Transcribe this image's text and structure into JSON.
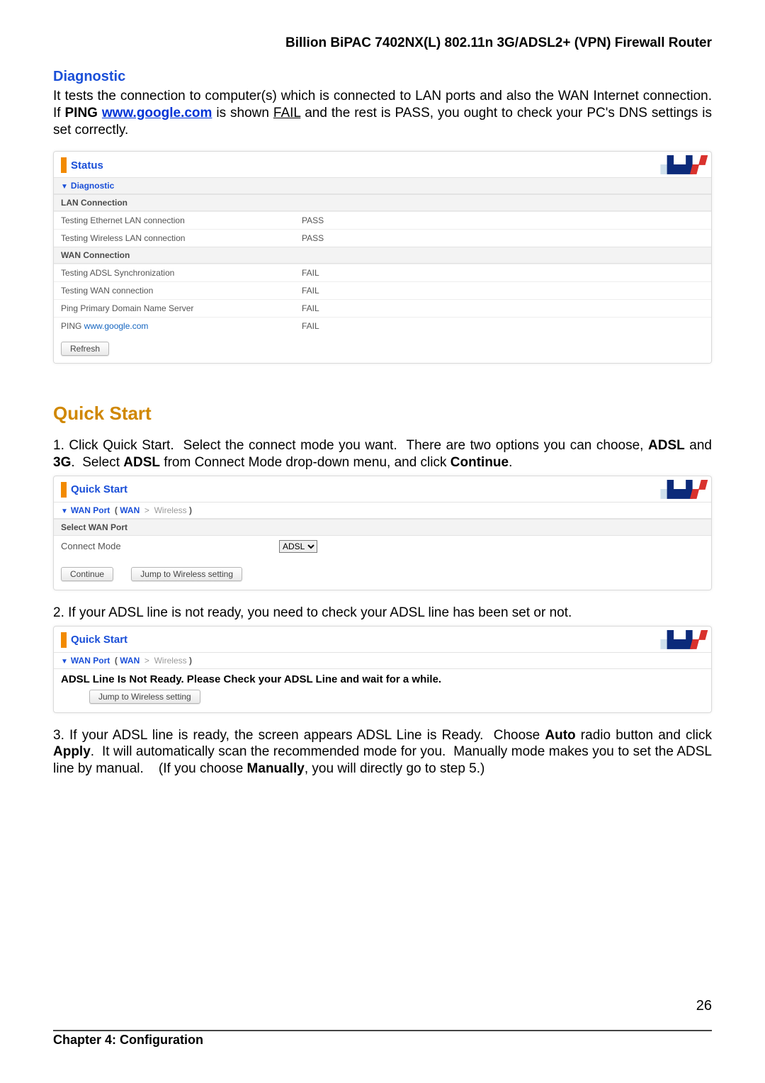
{
  "document": {
    "title": "Billion BiPAC 7402NX(L) 802.11n 3G/ADSL2+ (VPN) Firewall Router",
    "chapter": "Chapter 4: Configuration",
    "page_number": "26"
  },
  "diag_section": {
    "heading": "Diagnostic",
    "para_before": "It tests the connection to computer(s) which is connected to LAN ports and also the WAN Internet connection.  If ",
    "ping_bold": "PING ",
    "ping_link": "www.google.com",
    "para_mid": " is shown ",
    "fail_word": "FAIL",
    "para_after": " and the rest is PASS, you ought to check your PC's DNS settings is set correctly."
  },
  "diag_panel": {
    "title": "Status",
    "sub": "Diagnostic",
    "lan_header": "LAN Connection",
    "wan_header": "WAN Connection",
    "rows_lan": [
      {
        "name": "Testing Ethernet LAN connection",
        "result": "PASS"
      },
      {
        "name": "Testing Wireless LAN connection",
        "result": "PASS"
      }
    ],
    "rows_wan": [
      {
        "name": "Testing ADSL Synchronization",
        "result": "FAIL"
      },
      {
        "name": "Testing WAN connection",
        "result": "FAIL"
      },
      {
        "name": "Ping Primary Domain Name Server",
        "result": "FAIL"
      },
      {
        "name_prefix": "PING ",
        "link": "www.google.com",
        "result": "FAIL"
      }
    ],
    "refresh_label": "Refresh"
  },
  "quickstart": {
    "heading": "Quick Start",
    "step1": "1. Click Quick Start.  Select the connect mode you want.  There are two options you can choose, ADSL and 3G.  Select ADSL from Connect Mode drop-down menu, and click Continue.",
    "step2": "2. If your ADSL line is not ready, you need to check your ADSL line has been set or not.",
    "step3": "3. If your ADSL line is ready, the screen appears ADSL Line is Ready.  Choose Auto radio button and click Apply.  It will automatically scan the recommended mode for you.  Manually mode makes you to set the ADSL line by manual.     (If you choose Manually, you will directly go to step 5.)",
    "panel_title": "Quick Start",
    "crumb_label": "WAN Port",
    "crumb_wan": "WAN",
    "crumb_sep": ">",
    "crumb_wless": "Wireless",
    "select_wan_port": "Select WAN Port",
    "connect_mode_label": "Connect Mode",
    "connect_mode_value": "ADSL",
    "continue_label": "Continue",
    "jump_label": "Jump to Wireless setting",
    "not_ready_msg": "ADSL Line Is Not Ready. Please Check your ADSL Line and wait for a while."
  }
}
